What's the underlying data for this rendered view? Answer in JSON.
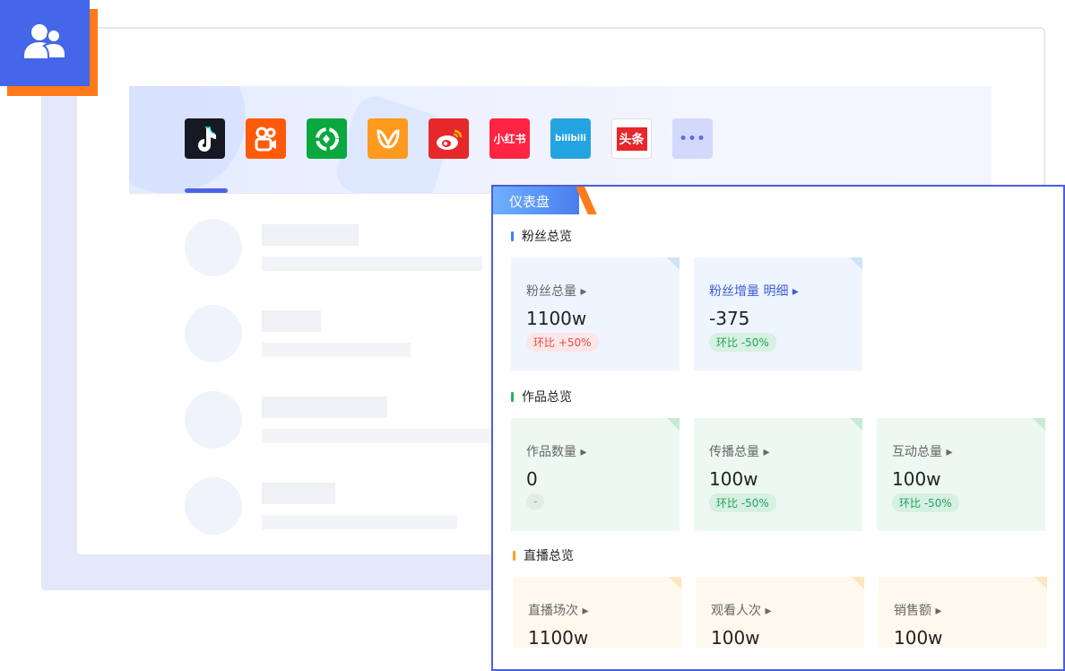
{
  "platform_tabs": [
    {
      "name": "douyin-icon",
      "color": "#161823",
      "text": "♪"
    },
    {
      "name": "kuaishou-icon",
      "color": "#ff5a0a",
      "text": ""
    },
    {
      "name": "shipinhao-icon",
      "color": "#0aa83e",
      "text": ""
    },
    {
      "name": "ixigua-icon",
      "color": "#ff9a1f",
      "text": ""
    },
    {
      "name": "weibo-icon",
      "color": "#e6282a",
      "text": ""
    },
    {
      "name": "xiaohongshu-icon",
      "color": "#ff2442",
      "text": "小红书"
    },
    {
      "name": "bilibili-icon",
      "color": "#23a4e0",
      "text": "bilibili"
    },
    {
      "name": "toutiao-icon",
      "color": "#ffffff",
      "text": "头条"
    },
    {
      "name": "more-icon",
      "color": "#d3d9fb",
      "text": "•••"
    }
  ],
  "dashboard": {
    "tab_label": "仪表盘",
    "sections": [
      {
        "title": "粉丝总览",
        "mark_color": "#3b82f6"
      },
      {
        "title": "作品总览",
        "mark_color": "#22b35e"
      },
      {
        "title": "直播总览",
        "mark_color": "#f5a623"
      }
    ],
    "fans": {
      "total_label": "粉丝总量 ▸",
      "total_value": "1100w",
      "total_change": "环比 +50%",
      "growth_label": "粉丝增量  明细 ▸",
      "growth_value": "-375",
      "growth_change": "环比 -50%"
    },
    "works": {
      "count_label": "作品数量 ▸",
      "count_value": "0",
      "count_change": "-",
      "spread_label": "传播总量 ▸",
      "spread_value": "100w",
      "spread_change": "环比 -50%",
      "interact_label": "互动总量 ▸",
      "interact_value": "100w",
      "interact_change": "环比 -50%"
    },
    "live": {
      "sessions_label": "直播场次 ▸",
      "sessions_value": "1100w",
      "viewers_label": "观看人次 ▸",
      "viewers_value": "100w",
      "sales_label": "销售额 ▸",
      "sales_value": "100w"
    }
  }
}
